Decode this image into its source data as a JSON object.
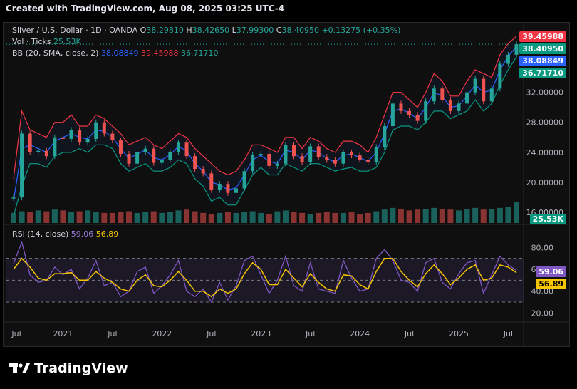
{
  "header": {
    "text": "Created with TradingView.com, Aug 08, 2025 03:25 UTC-4"
  },
  "legend": {
    "symbol": "Silver / U.S. Dollar · 1D · OANDA",
    "o_label": "O",
    "o_value": "38.29810",
    "h_label": "H",
    "h_value": "38.42650",
    "l_label": "L",
    "l_value": "37.99300",
    "c_label": "C",
    "c_value": "38.40950",
    "change": "+0.13275 (+0.35%)",
    "vol_label": "Vol · Ticks",
    "vol_value": "25.53K",
    "bb_label": "BB (20, SMA, close, 2)",
    "bb_basis": "38.08849",
    "bb_upper": "39.45988",
    "bb_lower": "36.71710",
    "rsi_label": "RSI (14, close)",
    "rsi_value": "59.06",
    "rsi_ma": "56.89"
  },
  "tags": {
    "upper": "39.45988",
    "close": "38.40950",
    "basis": "38.08849",
    "lower": "36.71710",
    "vol": "25.53K",
    "rsi": "59.06",
    "rsi_ma": "56.89"
  },
  "logo": {
    "text": "TradingView"
  },
  "colors": {
    "up": "#26a69a",
    "down": "#ef5350",
    "bb_upper": "#f23645",
    "bb_basis": "#2962ff",
    "bb_lower": "#089981",
    "rsi": "#7e57c2",
    "rsi_ma": "#f7c600"
  },
  "chart_data": [
    {
      "type": "line",
      "title": "Silver / U.S. Dollar · 1D · OANDA",
      "x_ticks": [
        "Jul",
        "2021",
        "Jul",
        "2022",
        "Jul",
        "2023",
        "Jul",
        "2024",
        "Jul",
        "2025",
        "Jul"
      ],
      "y_ticks": [
        "16.00000",
        "20.00000",
        "24.00000",
        "28.00000",
        "32.00000"
      ],
      "ylim": [
        14.5,
        40.5
      ],
      "x": [
        "2020-07",
        "2020-08",
        "2020-09",
        "2020-10",
        "2020-11",
        "2020-12",
        "2021-01",
        "2021-02",
        "2021-03",
        "2021-04",
        "2021-05",
        "2021-06",
        "2021-07",
        "2021-08",
        "2021-09",
        "2021-10",
        "2021-11",
        "2021-12",
        "2022-01",
        "2022-02",
        "2022-03",
        "2022-04",
        "2022-05",
        "2022-06",
        "2022-07",
        "2022-08",
        "2022-09",
        "2022-10",
        "2022-11",
        "2022-12",
        "2023-01",
        "2023-02",
        "2023-03",
        "2023-04",
        "2023-05",
        "2023-06",
        "2023-07",
        "2023-08",
        "2023-09",
        "2023-10",
        "2023-11",
        "2023-12",
        "2024-01",
        "2024-02",
        "2024-03",
        "2024-04",
        "2024-05",
        "2024-06",
        "2024-07",
        "2024-08",
        "2024-09",
        "2024-10",
        "2024-11",
        "2024-12",
        "2025-01",
        "2025-02",
        "2025-03",
        "2025-04",
        "2025-05",
        "2025-06",
        "2025-07",
        "2025-08"
      ],
      "series": [
        {
          "name": "Silver / U.S. Dollar",
          "values": [
            18.0,
            26.5,
            24.0,
            24.2,
            23.5,
            26.0,
            25.8,
            27.0,
            25.3,
            25.8,
            28.0,
            26.5,
            25.6,
            23.8,
            22.5,
            24.0,
            24.5,
            22.6,
            23.0,
            24.0,
            25.3,
            23.5,
            21.8,
            21.2,
            19.0,
            19.8,
            18.6,
            19.2,
            21.5,
            23.7,
            23.8,
            22.2,
            22.5,
            25.0,
            23.5,
            22.7,
            24.8,
            23.4,
            23.0,
            22.5,
            24.0,
            23.6,
            23.0,
            22.7,
            24.7,
            27.5,
            30.5,
            29.5,
            29.0,
            28.2,
            30.8,
            32.5,
            31.0,
            29.5,
            30.5,
            32.0,
            33.8,
            30.8,
            32.5,
            35.8,
            37.0,
            38.4
          ]
        },
        {
          "name": "BB upper",
          "values": [
            20.5,
            29.5,
            27.0,
            26.5,
            26.0,
            28.0,
            28.0,
            29.0,
            27.5,
            27.5,
            29.0,
            28.5,
            27.5,
            26.5,
            25.0,
            25.5,
            26.0,
            25.0,
            24.5,
            25.5,
            26.5,
            26.0,
            24.5,
            23.5,
            22.5,
            21.5,
            21.0,
            21.5,
            23.0,
            25.0,
            25.0,
            24.5,
            24.0,
            26.0,
            26.0,
            24.5,
            26.0,
            25.5,
            24.5,
            24.0,
            25.5,
            25.5,
            25.0,
            24.0,
            26.0,
            29.0,
            32.0,
            32.0,
            31.0,
            30.0,
            32.0,
            34.5,
            33.5,
            31.5,
            31.5,
            33.5,
            35.0,
            34.5,
            34.0,
            37.0,
            38.5,
            39.46
          ]
        },
        {
          "name": "BB basis",
          "values": [
            17.5,
            24.5,
            25.0,
            24.5,
            24.0,
            25.5,
            26.0,
            26.5,
            26.0,
            25.8,
            27.0,
            26.8,
            26.0,
            24.5,
            23.2,
            23.8,
            24.3,
            23.3,
            23.0,
            23.7,
            24.8,
            24.2,
            22.5,
            21.5,
            20.0,
            19.7,
            19.0,
            19.3,
            21.0,
            23.0,
            23.6,
            22.8,
            22.5,
            24.3,
            24.0,
            23.0,
            24.3,
            24.0,
            23.2,
            22.7,
            23.6,
            23.8,
            23.3,
            22.8,
            24.0,
            26.5,
            29.5,
            29.8,
            29.2,
            28.5,
            30.0,
            32.0,
            31.5,
            30.0,
            30.2,
            31.5,
            33.0,
            32.0,
            32.3,
            35.0,
            36.8,
            38.09
          ]
        },
        {
          "name": "BB lower",
          "values": [
            15.5,
            19.5,
            22.5,
            22.5,
            22.0,
            23.5,
            24.0,
            24.0,
            24.5,
            24.0,
            25.0,
            25.0,
            24.5,
            22.5,
            21.5,
            22.0,
            22.5,
            21.5,
            21.5,
            22.0,
            23.0,
            22.5,
            20.5,
            19.5,
            17.5,
            18.0,
            17.0,
            17.0,
            19.0,
            21.0,
            22.0,
            21.0,
            21.0,
            22.5,
            22.0,
            21.5,
            22.5,
            22.5,
            22.0,
            21.5,
            21.8,
            22.0,
            21.5,
            21.5,
            22.0,
            24.0,
            27.0,
            27.5,
            27.5,
            27.0,
            28.0,
            29.5,
            29.5,
            28.5,
            29.0,
            29.5,
            31.0,
            29.5,
            30.5,
            33.0,
            35.0,
            36.72
          ]
        }
      ]
    },
    {
      "type": "bar",
      "title": "Vol · Ticks",
      "last_value": "25.53K",
      "values": [
        12,
        14,
        13,
        15,
        14,
        16,
        15,
        13,
        14,
        15,
        13,
        12,
        12,
        13,
        14,
        12,
        13,
        14,
        12,
        13,
        15,
        16,
        14,
        12,
        11,
        12,
        13,
        12,
        13,
        14,
        12,
        11,
        14,
        15,
        13,
        12,
        11,
        12,
        13,
        12,
        12,
        13,
        11,
        12,
        14,
        16,
        18,
        17,
        15,
        16,
        17,
        18,
        17,
        16,
        15,
        17,
        18,
        16,
        17,
        18,
        19,
        25.53
      ]
    },
    {
      "type": "line",
      "title": "RSI (14, close)",
      "y_ticks": [
        "20.00",
        "40.00",
        "60.00",
        "80.00"
      ],
      "ylim": [
        15,
        90
      ],
      "series": [
        {
          "name": "RSI",
          "values": [
            65,
            85,
            55,
            48,
            50,
            62,
            55,
            60,
            42,
            52,
            68,
            45,
            48,
            35,
            40,
            58,
            62,
            38,
            45,
            55,
            68,
            40,
            35,
            42,
            30,
            48,
            32,
            45,
            68,
            72,
            55,
            38,
            50,
            72,
            45,
            40,
            66,
            42,
            40,
            38,
            68,
            52,
            40,
            42,
            70,
            78,
            68,
            50,
            48,
            40,
            66,
            70,
            48,
            42,
            56,
            66,
            68,
            38,
            55,
            72,
            64,
            59.06
          ]
        },
        {
          "name": "RSI-based MA",
          "values": [
            60,
            70,
            62,
            52,
            50,
            56,
            56,
            57,
            50,
            50,
            58,
            52,
            48,
            42,
            40,
            50,
            55,
            45,
            44,
            50,
            58,
            50,
            40,
            40,
            35,
            42,
            38,
            42,
            56,
            66,
            60,
            46,
            46,
            60,
            52,
            44,
            56,
            48,
            42,
            40,
            55,
            54,
            46,
            42,
            58,
            70,
            70,
            58,
            50,
            44,
            56,
            64,
            56,
            46,
            52,
            60,
            64,
            50,
            52,
            64,
            62,
            56.89
          ]
        }
      ]
    }
  ]
}
